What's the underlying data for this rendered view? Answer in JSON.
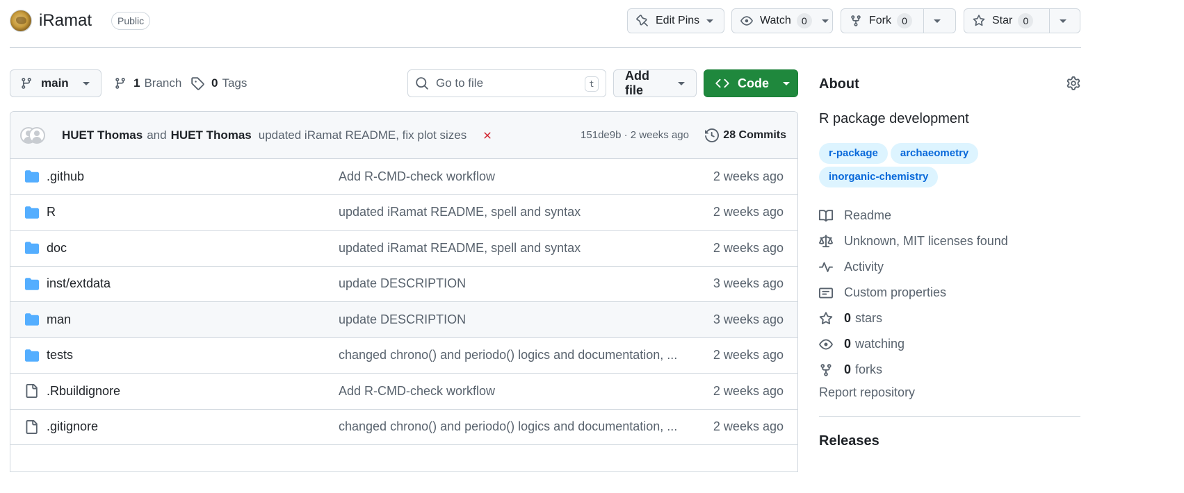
{
  "repo": {
    "name": "iRamat",
    "visibility": "Public"
  },
  "header_actions": {
    "edit_pins": "Edit Pins",
    "watch": "Watch",
    "watch_count": "0",
    "fork": "Fork",
    "fork_count": "0",
    "star": "Star",
    "star_count": "0"
  },
  "toolbar": {
    "branch": "main",
    "branches_count": "1",
    "branches_label": "Branch",
    "tags_count": "0",
    "tags_label": "Tags",
    "search_placeholder": "Go to file",
    "search_shortcut": "t",
    "add_file": "Add file",
    "code": "Code"
  },
  "latest_commit": {
    "author1": "HUET Thomas",
    "and": "and",
    "author2": "HUET Thomas",
    "message": "updated iRamat README, fix plot sizes",
    "status": "failed",
    "meta": "151de9b · 2 weeks ago",
    "commits_label": "28 Commits"
  },
  "files": [
    {
      "type": "folder",
      "name": ".github",
      "message": "Add R-CMD-check workflow",
      "date": "2 weeks ago"
    },
    {
      "type": "folder",
      "name": "R",
      "message": "updated iRamat README, spell and syntax",
      "date": "2 weeks ago"
    },
    {
      "type": "folder",
      "name": "doc",
      "message": "updated iRamat README, spell and syntax",
      "date": "2 weeks ago"
    },
    {
      "type": "folder",
      "name": "inst/extdata",
      "message": "update DESCRIPTION",
      "date": "3 weeks ago"
    },
    {
      "type": "folder",
      "name": "man",
      "message": "update DESCRIPTION",
      "date": "3 weeks ago"
    },
    {
      "type": "folder",
      "name": "tests",
      "message": "changed chrono() and periodo() logics and documentation, ...",
      "date": "2 weeks ago"
    },
    {
      "type": "file",
      "name": ".Rbuildignore",
      "message": "Add R-CMD-check workflow",
      "date": "2 weeks ago"
    },
    {
      "type": "file",
      "name": ".gitignore",
      "message": "changed chrono() and periodo() logics and documentation, ...",
      "date": "2 weeks ago"
    }
  ],
  "about": {
    "title": "About",
    "description": "R package development",
    "topics": [
      "r-package",
      "archaeometry",
      "inorganic-chemistry"
    ],
    "readme": "Readme",
    "license": "Unknown, MIT licenses found",
    "activity": "Activity",
    "custom_properties": "Custom properties",
    "stars_count": "0",
    "stars_label": "stars",
    "watching_count": "0",
    "watching_label": "watching",
    "forks_count": "0",
    "forks_label": "forks",
    "report": "Report repository",
    "releases": "Releases"
  },
  "colors": {
    "primary_button": "#1f883d",
    "link": "#0969da",
    "topic_bg": "#ddf4ff",
    "folder": "#54aeff",
    "fail": "#d1242f"
  }
}
